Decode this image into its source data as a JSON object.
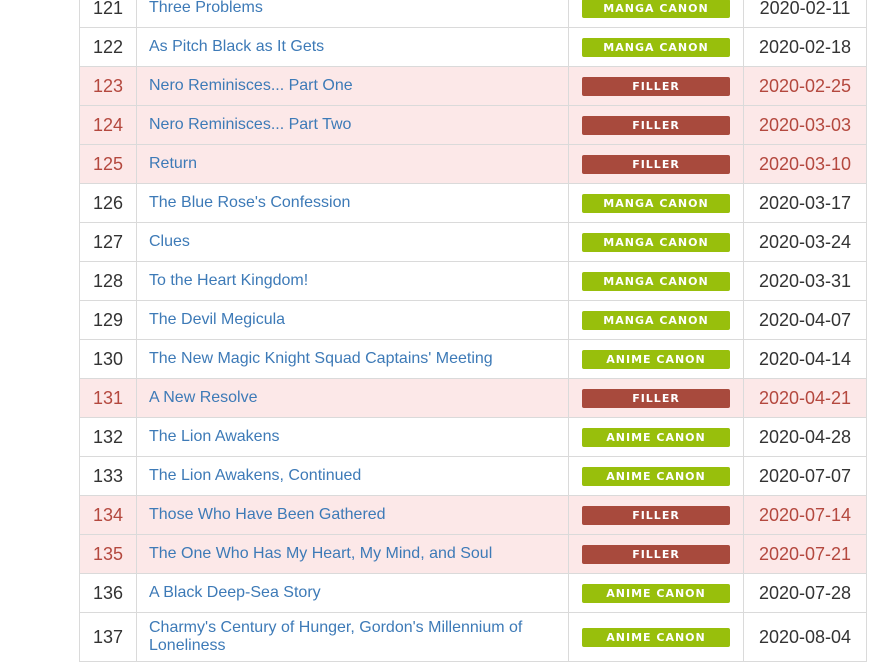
{
  "episodes": [
    {
      "num": "121",
      "title": "Three Problems",
      "type": "MANGA CANON",
      "kind": "manga",
      "date": "2020-02-11"
    },
    {
      "num": "122",
      "title": "As Pitch Black as It Gets",
      "type": "MANGA CANON",
      "kind": "manga",
      "date": "2020-02-18"
    },
    {
      "num": "123",
      "title": "Nero Reminisces... Part One",
      "type": "FILLER",
      "kind": "filler",
      "date": "2020-02-25"
    },
    {
      "num": "124",
      "title": "Nero Reminisces... Part Two",
      "type": "FILLER",
      "kind": "filler",
      "date": "2020-03-03"
    },
    {
      "num": "125",
      "title": "Return",
      "type": "FILLER",
      "kind": "filler",
      "date": "2020-03-10"
    },
    {
      "num": "126",
      "title": "The Blue Rose's Confession",
      "type": "MANGA CANON",
      "kind": "manga",
      "date": "2020-03-17"
    },
    {
      "num": "127",
      "title": "Clues",
      "type": "MANGA CANON",
      "kind": "manga",
      "date": "2020-03-24"
    },
    {
      "num": "128",
      "title": "To the Heart Kingdom!",
      "type": "MANGA CANON",
      "kind": "manga",
      "date": "2020-03-31"
    },
    {
      "num": "129",
      "title": "The Devil Megicula",
      "type": "MANGA CANON",
      "kind": "manga",
      "date": "2020-04-07"
    },
    {
      "num": "130",
      "title": "The New Magic Knight Squad Captains' Meeting",
      "type": "ANIME CANON",
      "kind": "anime",
      "date": "2020-04-14"
    },
    {
      "num": "131",
      "title": "A New Resolve",
      "type": "FILLER",
      "kind": "filler",
      "date": "2020-04-21"
    },
    {
      "num": "132",
      "title": "The Lion Awakens",
      "type": "ANIME CANON",
      "kind": "anime",
      "date": "2020-04-28"
    },
    {
      "num": "133",
      "title": "The Lion Awakens, Continued",
      "type": "ANIME CANON",
      "kind": "anime",
      "date": "2020-07-07"
    },
    {
      "num": "134",
      "title": "Those Who Have Been Gathered",
      "type": "FILLER",
      "kind": "filler",
      "date": "2020-07-14"
    },
    {
      "num": "135",
      "title": "The One Who Has My Heart, My Mind, and Soul",
      "type": "FILLER",
      "kind": "filler",
      "date": "2020-07-21"
    },
    {
      "num": "136",
      "title": "A Black Deep-Sea Story",
      "type": "ANIME CANON",
      "kind": "anime",
      "date": "2020-07-28"
    },
    {
      "num": "137",
      "title": "Charmy's Century of Hunger, Gordon's Millennium of Loneliness",
      "type": "ANIME CANON",
      "kind": "anime",
      "date": "2020-08-04"
    }
  ],
  "colors": {
    "manga_canon": "#98bf0c",
    "anime_canon": "#98bf0c",
    "filler": "#a84a3d",
    "filler_row_bg": "#fce8e8",
    "link": "#3d7ab7"
  }
}
